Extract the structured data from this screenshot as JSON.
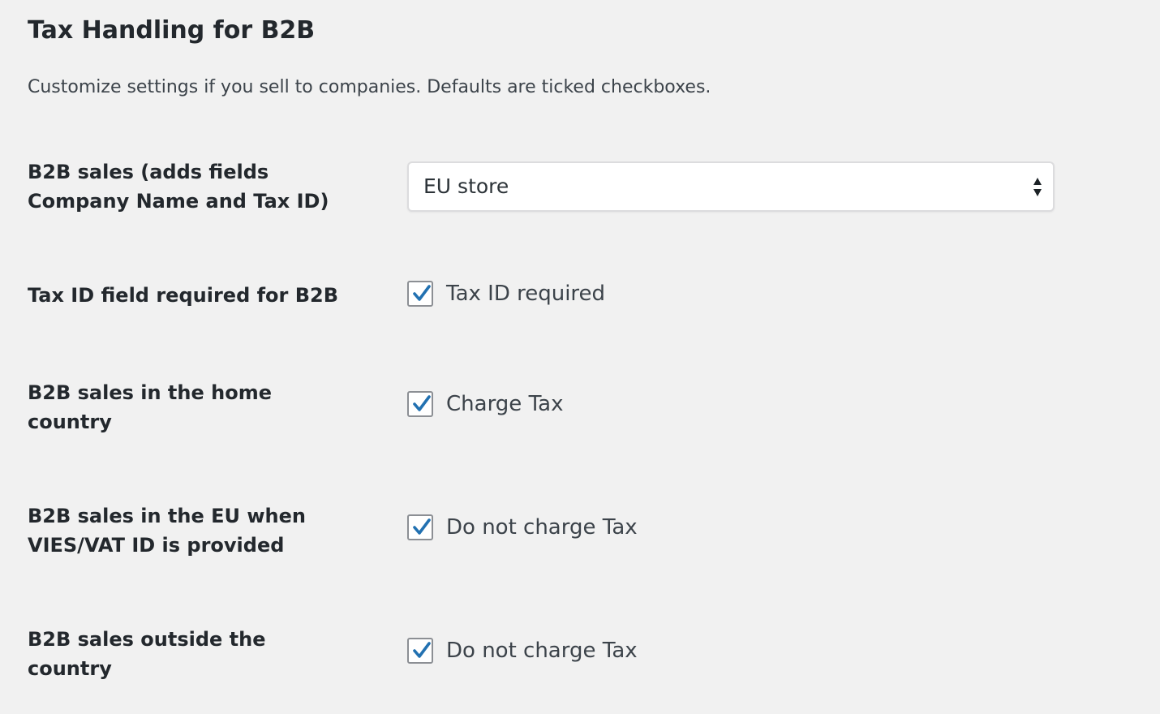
{
  "section": {
    "title": "Tax Handling for B2B",
    "description": "Customize settings if you sell to companies. Defaults are ticked checkboxes."
  },
  "settings": [
    {
      "label_lines": [
        "B2B sales (adds fields",
        "Company Name and Tax ID)"
      ],
      "control": "select",
      "value": "EU store"
    },
    {
      "label_lines": [
        "Tax ID field required for B2B"
      ],
      "control": "checkbox",
      "checked": true,
      "option_label": "Tax ID required"
    },
    {
      "label_lines": [
        "B2B sales in the home",
        "country"
      ],
      "control": "checkbox",
      "checked": true,
      "option_label": "Charge Tax"
    },
    {
      "label_lines": [
        "B2B sales in the EU when",
        "VIES/VAT ID is provided"
      ],
      "control": "checkbox",
      "checked": true,
      "option_label": "Do not charge Tax"
    },
    {
      "label_lines": [
        "B2B sales outside the",
        "country"
      ],
      "control": "checkbox",
      "checked": true,
      "option_label": "Do not charge Tax"
    }
  ],
  "colors": {
    "background": "#f1f1f1",
    "checkmark": "#2271b1",
    "text": "#23282d"
  }
}
